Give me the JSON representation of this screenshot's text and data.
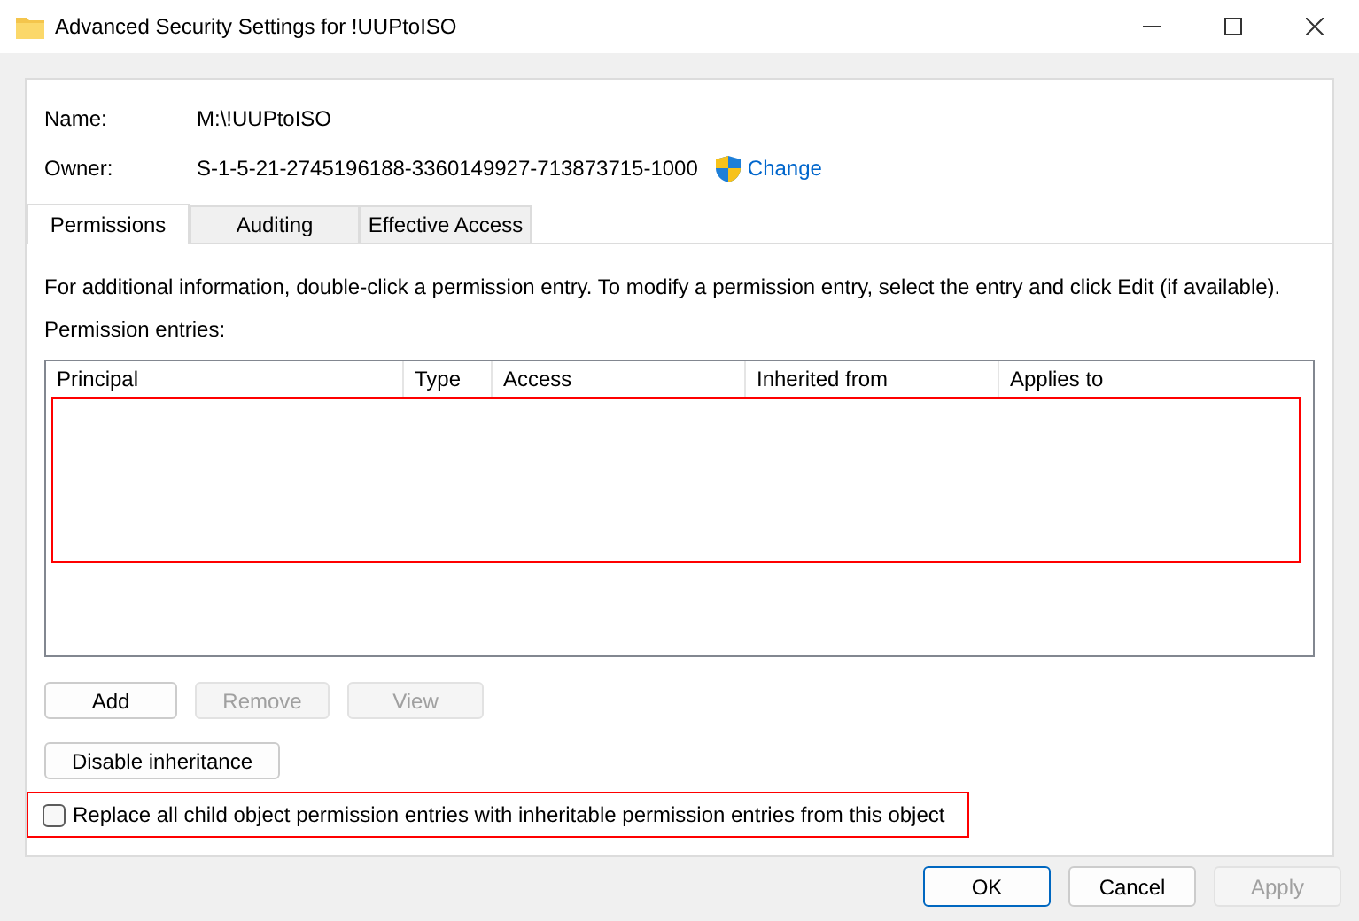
{
  "window": {
    "title": "Advanced Security Settings for !UUPtoISO"
  },
  "name": {
    "label": "Name:",
    "value": "M:\\!UUPtoISO"
  },
  "owner": {
    "label": "Owner:",
    "value": "S-1-5-21-2745196188-3360149927-713873715-1000",
    "change_link": "Change"
  },
  "tabs": [
    {
      "label": "Permissions",
      "selected": true
    },
    {
      "label": "Auditing",
      "selected": false
    },
    {
      "label": "Effective Access",
      "selected": false
    }
  ],
  "info_text": "For additional information, double-click a permission entry. To modify a permission entry, select the entry and click Edit (if available).",
  "entries_label": "Permission entries:",
  "table": {
    "columns": [
      "Principal",
      "Type",
      "Access",
      "Inherited from",
      "Applies to"
    ],
    "highlighted": true
  },
  "entry_buttons": [
    {
      "label": "Add",
      "disabled": false
    },
    {
      "label": "Remove",
      "disabled": true
    },
    {
      "label": "View",
      "disabled": true
    }
  ],
  "inheritance_button": {
    "label": "Disable inheritance",
    "disabled": false
  },
  "replace_checkbox": {
    "label": "Replace all child object permission entries with inheritable permission entries from this object",
    "checked": false,
    "highlighted": true
  },
  "dialog_buttons": [
    {
      "label": "OK",
      "disabled": false,
      "default": true
    },
    {
      "label": "Cancel",
      "disabled": false,
      "default": false
    },
    {
      "label": "Apply",
      "disabled": true,
      "default": false
    }
  ]
}
